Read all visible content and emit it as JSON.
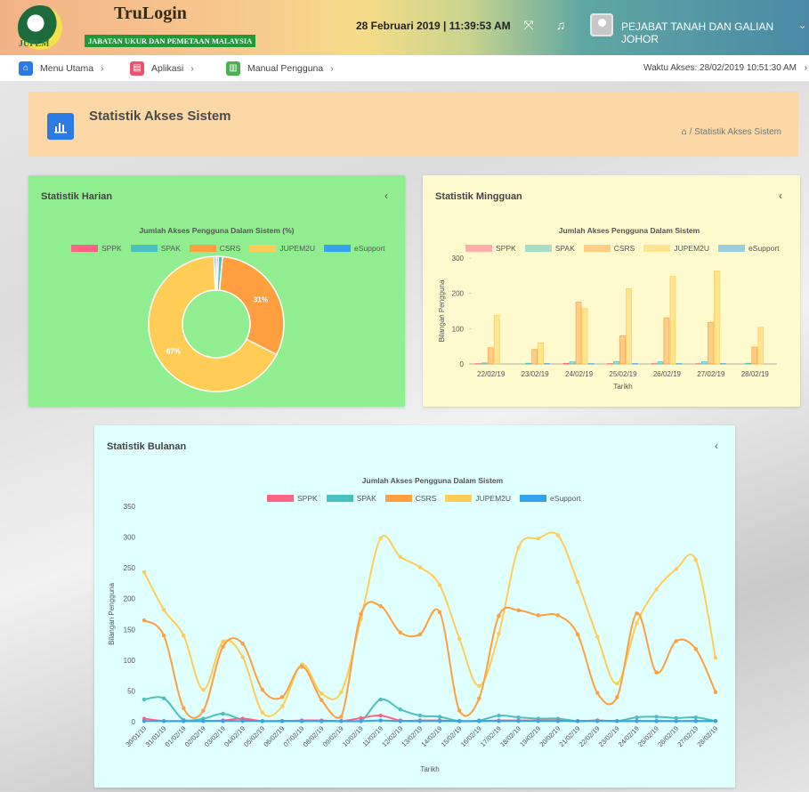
{
  "header": {
    "logo_sub": "JUPEM",
    "app_title": "TruLogin",
    "app_subtitle": "JABATAN UKUR DAN PEMETAAN MALAYSIA",
    "datetime": "28 Februari 2019 | 11:39:53 AM",
    "office": "PEJABAT TANAH DAN GALIAN JOHOR",
    "icons": [
      "fullscreen-icon",
      "bell-icon",
      "avatar-icon",
      "chevron-down-icon"
    ]
  },
  "nav": {
    "items": [
      {
        "label": "Menu Utama",
        "icon": "home-icon",
        "color": "#2c7be5"
      },
      {
        "label": "Aplikasi",
        "icon": "apps-icon",
        "color": "#f0506e"
      },
      {
        "label": "Manual Pengguna",
        "icon": "book-icon",
        "color": "#4caf50"
      }
    ],
    "access_time": "Waktu Akses: 28/02/2019 10:51:30 AM"
  },
  "page": {
    "title": "Statistik Akses Sistem",
    "breadcrumb": "Statistik Akses Sistem"
  },
  "colors": {
    "SPPK": "#ff6384",
    "SPAK": "#4bc0c0",
    "CSRS": "#ff9f40",
    "JUPEM2U": "#ffcd56",
    "eSupport": "#36a2eb"
  },
  "cards": {
    "harian": {
      "title": "Statistik Harian",
      "bg": "#90ee90"
    },
    "mingguan": {
      "title": "Statistik Mingguan",
      "bg": "#fffacd"
    },
    "bulanan": {
      "title": "Statistik Bulanan",
      "bg": "#e0ffff"
    }
  },
  "chart_data": [
    {
      "type": "pie",
      "title": "Jumlah Akses Pengguna Dalam Sistem (%)",
      "labels": [
        "SPPK",
        "SPAK",
        "CSRS",
        "JUPEM2U",
        "eSupport"
      ],
      "values": [
        0.5,
        1,
        31,
        67,
        0.5
      ],
      "data_labels": [
        "",
        "",
        "31%",
        "67%",
        ""
      ]
    },
    {
      "type": "bar",
      "title": "Jumlah Akses Pengguna Dalam Sistem",
      "xlabel": "Tarikh",
      "ylabel": "Bilangan Pengguna",
      "ylim": [
        0,
        300
      ],
      "yticks": [
        0,
        100,
        200,
        300
      ],
      "categories": [
        "22/02/19",
        "23/02/19",
        "24/02/19",
        "25/02/19",
        "26/02/19",
        "27/02/19",
        "28/02/19"
      ],
      "series": [
        {
          "name": "SPPK",
          "values": [
            1,
            0,
            2,
            1,
            1,
            1,
            0
          ]
        },
        {
          "name": "SPAK",
          "values": [
            3,
            2,
            6,
            7,
            6,
            6,
            2
          ]
        },
        {
          "name": "CSRS",
          "values": [
            46,
            41,
            175,
            80,
            131,
            118,
            48
          ]
        },
        {
          "name": "JUPEM2U",
          "values": [
            137,
            60,
            157,
            213,
            248,
            263,
            104
          ]
        },
        {
          "name": "eSupport",
          "values": [
            0,
            1,
            1,
            1,
            1,
            1,
            0
          ]
        }
      ]
    },
    {
      "type": "line",
      "title": "Jumlah Akses Pengguna Dalam Sistem",
      "xlabel": "Tarikh",
      "ylabel": "Bilangan Pengguna",
      "ylim": [
        0,
        350
      ],
      "yticks": [
        0,
        50,
        100,
        150,
        200,
        250,
        300,
        350
      ],
      "categories": [
        "30/01/19",
        "31/01/19",
        "01/02/19",
        "02/02/19",
        "03/02/19",
        "04/02/19",
        "05/02/19",
        "06/02/19",
        "07/02/19",
        "08/02/19",
        "09/02/19",
        "10/02/19",
        "11/02/19",
        "12/02/19",
        "13/02/19",
        "14/02/19",
        "15/02/19",
        "16/02/19",
        "17/02/19",
        "18/02/19",
        "19/02/19",
        "20/02/19",
        "21/02/19",
        "22/02/19",
        "23/02/19",
        "24/02/19",
        "25/02/19",
        "26/02/19",
        "27/02/19",
        "28/02/19"
      ],
      "series": [
        {
          "name": "SPPK",
          "values": [
            5,
            1,
            1,
            1,
            2,
            5,
            1,
            1,
            2,
            2,
            1,
            6,
            10,
            2,
            2,
            2,
            1,
            1,
            2,
            2,
            2,
            2,
            1,
            2,
            1,
            1,
            1,
            1,
            1,
            1
          ]
        },
        {
          "name": "SPAK",
          "values": [
            36,
            38,
            3,
            5,
            13,
            3,
            1,
            1,
            1,
            1,
            1,
            1,
            36,
            20,
            10,
            8,
            1,
            2,
            10,
            7,
            5,
            5,
            1,
            2,
            1,
            7,
            8,
            6,
            7,
            1
          ]
        },
        {
          "name": "CSRS",
          "values": [
            165,
            140,
            22,
            18,
            122,
            127,
            52,
            40,
            90,
            35,
            8,
            175,
            188,
            145,
            142,
            178,
            18,
            38,
            172,
            181,
            173,
            173,
            142,
            47,
            40,
            176,
            80,
            131,
            118,
            48
          ]
        },
        {
          "name": "JUPEM2U",
          "values": [
            243,
            182,
            140,
            52,
            130,
            105,
            15,
            25,
            93,
            46,
            48,
            167,
            298,
            268,
            251,
            222,
            135,
            58,
            143,
            283,
            298,
            303,
            227,
            138,
            62,
            160,
            215,
            248,
            263,
            104
          ]
        },
        {
          "name": "eSupport",
          "values": [
            1,
            1,
            1,
            1,
            1,
            1,
            1,
            1,
            1,
            1,
            1,
            1,
            2,
            1,
            1,
            1,
            1,
            1,
            1,
            1,
            1,
            1,
            1,
            1,
            1,
            1,
            1,
            1,
            1,
            1
          ]
        }
      ]
    }
  ]
}
